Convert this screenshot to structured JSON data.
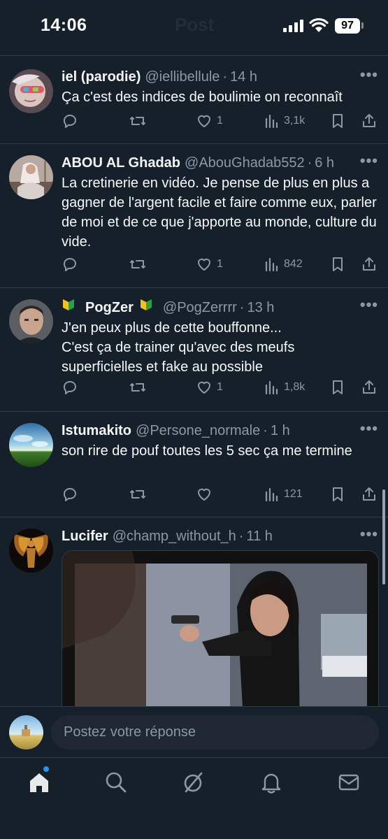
{
  "status_bar": {
    "time": "14:06",
    "battery": "97",
    "header_ghost": "Post"
  },
  "tweets": [
    {
      "name": "iel (parodie)",
      "handle": "@iellibellule",
      "time": "14 h",
      "text": "Ça c'est des indices de boulimie on reconnaît",
      "likes": "1",
      "views": "3,1k"
    },
    {
      "name": "ABOU AL Ghadab",
      "handle": "@AbouGhadab552",
      "time": "6 h",
      "text": "La cretinerie en vidéo. Je pense de plus en plus a gagner de l'argent facile et faire comme eux, parler de moi et de ce que j'apporte au monde, culture du vide.",
      "likes": "1",
      "views": "842"
    },
    {
      "name": "PogZer",
      "handle": "@PogZerrrr",
      "time": "13 h",
      "text": "J'en peux plus de cette bouffonne...\nC'est ça de trainer qu'avec des meufs superficielles et fake au possible",
      "likes": "1",
      "views": "1,8k"
    },
    {
      "name": "Istumakito",
      "handle": "@Persone_normale",
      "time": "1 h",
      "text": "son rire de pouf toutes les 5 sec ça me termine",
      "likes": "",
      "views": "121"
    },
    {
      "name": "Lucifer",
      "handle": "@champ_without_h",
      "time": "11 h",
      "text": ""
    }
  ],
  "reply": {
    "placeholder": "Postez votre réponse"
  },
  "tabs": [
    "home-icon",
    "search-icon",
    "grok-icon",
    "notifications-icon",
    "messages-icon"
  ],
  "colors": {
    "background": "#15202b",
    "divider": "#2f3b47",
    "muted": "#8b98a5",
    "accent": "#1d9bf0"
  }
}
